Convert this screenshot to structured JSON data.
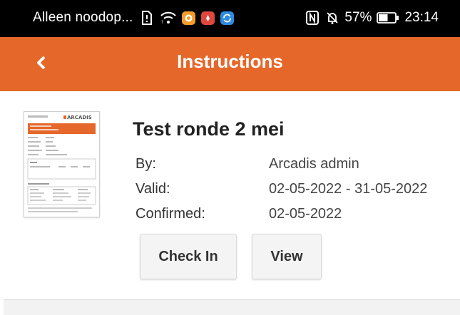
{
  "status_bar": {
    "carrier": "Alleen noodop...",
    "battery_percent": "57%",
    "battery_level": 57,
    "time": "23:14",
    "left_icons": [
      "sim-alert-icon",
      "wifi-icon",
      "app-notification-icon",
      "huawei-app-icon",
      "sync-app-icon"
    ],
    "right_icons": [
      "nfc-icon",
      "mute-icon",
      "battery-icon"
    ]
  },
  "app_bar": {
    "title": "Instructions",
    "back_icon": "chevron-left-icon",
    "color": "#e5672a"
  },
  "instruction": {
    "title": "Test ronde 2 mei",
    "thumbnail_brand": "ARCADIS",
    "fields": [
      {
        "label": "By:",
        "value": "Arcadis admin"
      },
      {
        "label": "Valid:",
        "value": "02-05-2022 - 31-05-2022"
      },
      {
        "label": "Confirmed:",
        "value": "02-05-2022"
      }
    ],
    "buttons": {
      "check_in": "Check In",
      "view": "View"
    }
  }
}
